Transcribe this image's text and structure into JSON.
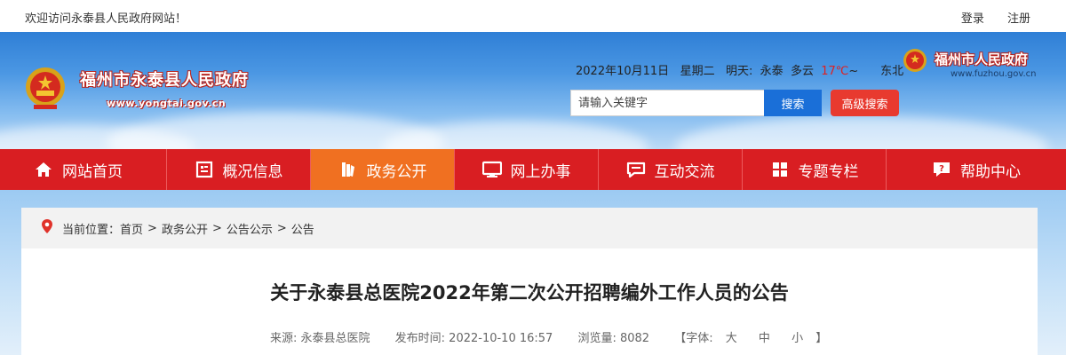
{
  "topbar": {
    "welcome": "欢迎访问永泰县人民政府网站！",
    "login": "登录",
    "register": "注册"
  },
  "header": {
    "site_name": "福州市永泰县人民政府",
    "site_url": "www.yongtai.gov.cn",
    "date": "2022年10月11日",
    "weekday": "星期二",
    "tomorrow_label": "明天:",
    "city": "永泰",
    "weather": "多云",
    "temp": "17℃",
    "temp_sep": "~",
    "wind": "东北",
    "parent_site_name": "福州市人民政府",
    "parent_site_url": "www.fuzhou.gov.cn"
  },
  "search": {
    "placeholder": "请输入关键字",
    "button": "搜索",
    "advanced": "高级搜索"
  },
  "nav": [
    {
      "label": "网站首页",
      "icon": "home-icon"
    },
    {
      "label": "概况信息",
      "icon": "info-card-icon"
    },
    {
      "label": "政务公开",
      "icon": "document-icon",
      "active": true
    },
    {
      "label": "网上办事",
      "icon": "monitor-icon"
    },
    {
      "label": "互动交流",
      "icon": "chat-icon"
    },
    {
      "label": "专题专栏",
      "icon": "grid-icon"
    },
    {
      "label": "帮助中心",
      "icon": "help-icon"
    }
  ],
  "breadcrumb": {
    "prefix": "当前位置：",
    "items": [
      "首页",
      "政务公开",
      "公告公示",
      "公告"
    ],
    "separator": ">"
  },
  "article": {
    "title": "关于永泰县总医院2022年第二次公开招聘编外工作人员的公告",
    "source_label": "来源: 永泰县总医院",
    "time_label": "发布时间: 2022-10-10 16:57",
    "views_label": "浏览量: 8082",
    "font_label": "【字体:",
    "font_large": "大",
    "font_medium": "中",
    "font_small": "小",
    "font_close": "】"
  },
  "colors": {
    "nav_red": "#d91e22",
    "nav_active": "#f07021",
    "search_blue": "#1a6fd8",
    "advanced_red": "#e83a2f"
  }
}
